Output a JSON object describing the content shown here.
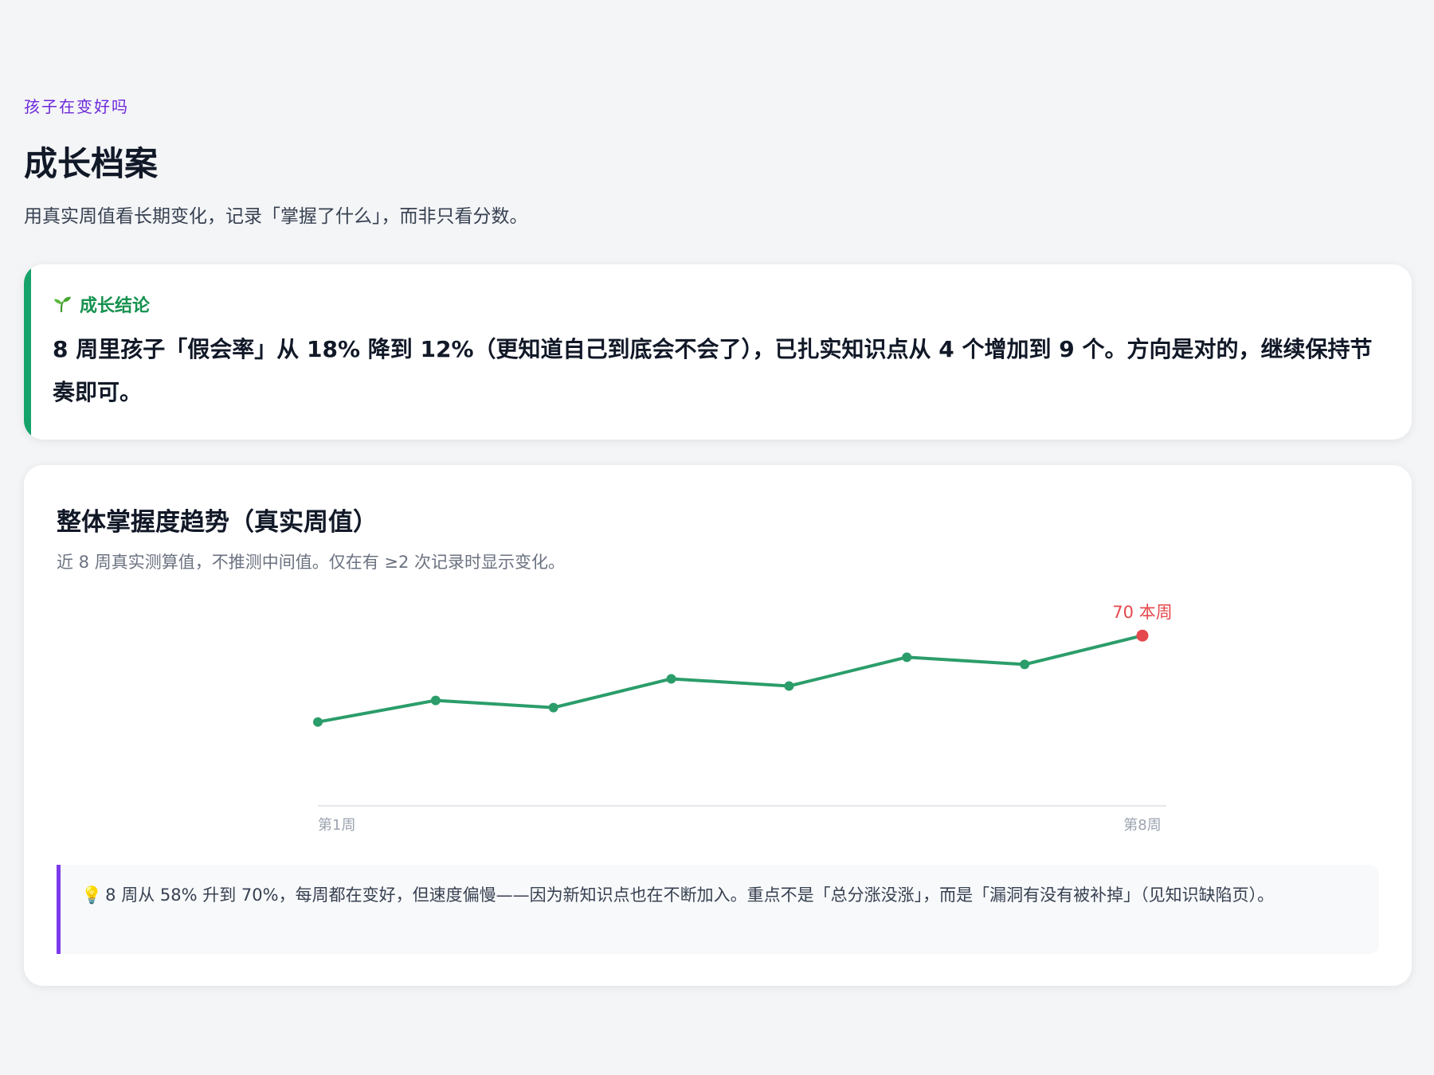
{
  "header": {
    "kicker": "孩子在变好吗",
    "title": "成长档案",
    "subtitle": "用真实周值看长期变化，记录「掌握了什么」，而非只看分数。"
  },
  "conclusion": {
    "label": "成长结论",
    "icon": "sprout-icon",
    "text": "8 周里孩子「假会率」从 18% 降到 12%（更知道自己到底会不会了），已扎实知识点从 4 个增加到 9 个。方向是对的，继续保持节奏即可。",
    "accent_color": "#16a36b"
  },
  "trend": {
    "title": "整体掌握度趋势（真实周值）",
    "subtitle": "近 8 周真实测算值，不推测中间值。仅在有 ≥2 次记录时显示变化。",
    "note_icon": "lightbulb-icon",
    "note": "8 周从 58% 升到 70%，每周都在变好，但速度偏慢——因为新知识点也在不断加入。重点不是「总分涨没涨」，而是「漏洞有没有被补掉」（见知识缺陷页）。"
  },
  "chart_data": {
    "type": "line",
    "x": [
      1,
      2,
      3,
      4,
      5,
      6,
      7,
      8
    ],
    "series": [
      {
        "values": [
          58,
          61,
          60,
          64,
          63,
          67,
          66,
          70
        ],
        "color": "#2b9d6a"
      }
    ],
    "tick_labels": [
      "第1周",
      "第8周"
    ],
    "highlight": {
      "index": 7,
      "label": "70 本周",
      "color": "#e5484d"
    },
    "ylim": [
      50,
      76
    ],
    "grid": false
  }
}
